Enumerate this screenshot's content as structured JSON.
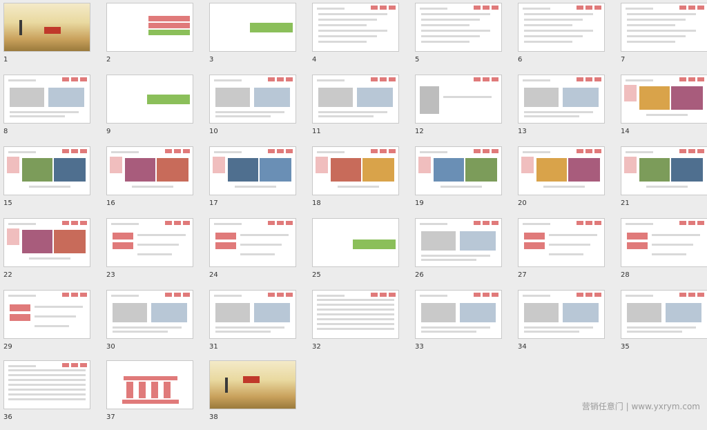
{
  "slides": [
    {
      "n": "1"
    },
    {
      "n": "2"
    },
    {
      "n": "3"
    },
    {
      "n": "4"
    },
    {
      "n": "5"
    },
    {
      "n": "6"
    },
    {
      "n": "7"
    },
    {
      "n": "8"
    },
    {
      "n": "9"
    },
    {
      "n": "10"
    },
    {
      "n": "11"
    },
    {
      "n": "12"
    },
    {
      "n": "13"
    },
    {
      "n": "14"
    },
    {
      "n": "15"
    },
    {
      "n": "16"
    },
    {
      "n": "17"
    },
    {
      "n": "18"
    },
    {
      "n": "19"
    },
    {
      "n": "20"
    },
    {
      "n": "21"
    },
    {
      "n": "22"
    },
    {
      "n": "23"
    },
    {
      "n": "24"
    },
    {
      "n": "25"
    },
    {
      "n": "26"
    },
    {
      "n": "27"
    },
    {
      "n": "28"
    },
    {
      "n": "29"
    },
    {
      "n": "30"
    },
    {
      "n": "31"
    },
    {
      "n": "32"
    },
    {
      "n": "33"
    },
    {
      "n": "34"
    },
    {
      "n": "35"
    },
    {
      "n": "36"
    },
    {
      "n": "37"
    },
    {
      "n": "38"
    }
  ],
  "watermark": "营销任意门 | www.yxrym.com",
  "colors": {
    "accent_green": "#8bbf5a",
    "accent_red": "#e07a7a",
    "bg": "#ececec"
  }
}
